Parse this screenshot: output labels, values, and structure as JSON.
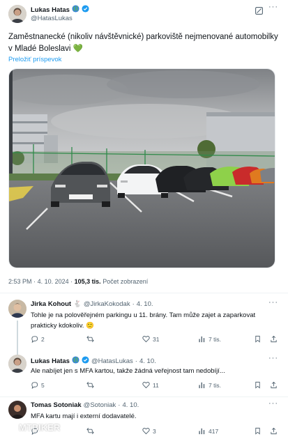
{
  "post": {
    "author_name": "Lukas Hatas",
    "author_handle": "@HatasLukas",
    "text": "Zaměstnanecké (nikoliv návštěvnické) parkoviště nejmenované automobilky v Mladé Boleslavi 💚",
    "translate_label": "Preložiť príspevok",
    "time": "2:53 PM",
    "date": "4. 10. 2024",
    "views_count": "105,3 tis.",
    "views_label": "Počet zobrazení",
    "separator": "·",
    "icons": [
      "earth-icon",
      "verified-icon",
      "grok-icon",
      "more-icon"
    ],
    "accent_color": "#1d9bf0"
  },
  "replies": [
    {
      "author_name": "Jirka Kohout",
      "badge_emoji": "🐇",
      "author_handle": "@JirkaKokodak",
      "date": "4. 10.",
      "text": "Tohle je na polověřejném parkingu u 11. brány. Tam může zajet a zaparkovat prakticky kdokoliv. 🙂",
      "replies_count": "2",
      "reposts_count": "",
      "likes_count": "31",
      "views_count": "7 tis."
    },
    {
      "author_name": "Lukas Hatas",
      "author_handle": "@HatasLukas",
      "date": "4. 10.",
      "text": "Ale nabíjet jen s MFA kartou, takže žádná veřejnost tam nedobíjí...",
      "replies_count": "5",
      "reposts_count": "",
      "likes_count": "11",
      "views_count": "7 tis."
    },
    {
      "author_name": "Tomas Sotoniak",
      "author_handle": "@Sotoniak",
      "date": "4. 10.",
      "text": "MFA kartu mají i externí dodavatelé.",
      "replies_count": "",
      "reposts_count": "",
      "likes_count": "3",
      "views_count": "417"
    }
  ],
  "watermark": "MTBIKER"
}
